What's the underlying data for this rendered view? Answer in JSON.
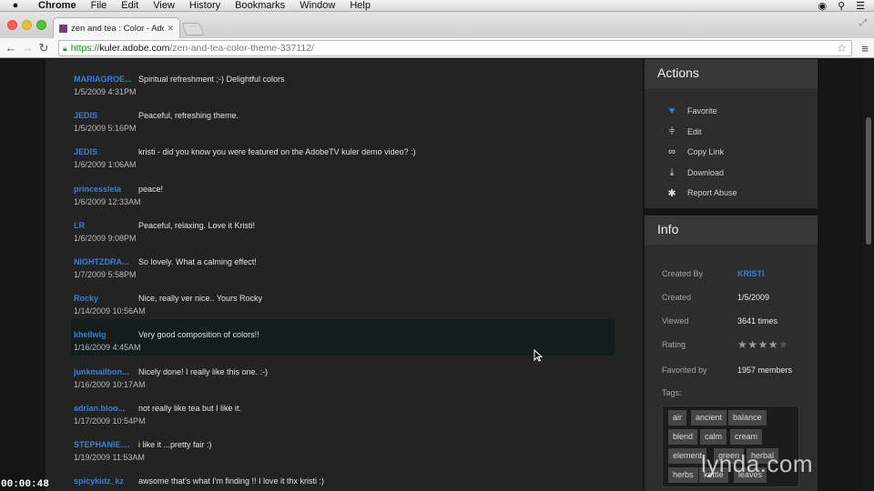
{
  "menubar": {
    "app": "Chrome",
    "items": [
      "File",
      "Edit",
      "View",
      "History",
      "Bookmarks",
      "Window",
      "Help"
    ]
  },
  "tab": {
    "title": "zen and tea : Color - Adobe"
  },
  "address": {
    "scheme": "https://",
    "host": "kuler.adobe.com",
    "path": "/zen-and-tea-color-theme-337112/"
  },
  "comments": [
    {
      "user": "MARIAGROE...",
      "date": "1/5/2009 4:31PM",
      "text": "Spiritual refreshment ;-) Delightful colors"
    },
    {
      "user": "JEDIS",
      "date": "1/5/2009 5:16PM",
      "text": "Peaceful, refreshing theme."
    },
    {
      "user": "JEDIS",
      "date": "1/6/2009 1:06AM",
      "text": "kristi - did you know you were featured on the AdobeTV kuler demo video? :)"
    },
    {
      "user": "princessleia",
      "date": "1/6/2009 12:33AM",
      "text": "peace!"
    },
    {
      "user": "LR",
      "date": "1/6/2009 9:08PM",
      "text": "Peaceful, relaxing. Love it Kristi!"
    },
    {
      "user": "NIGHTZDRA...",
      "date": "1/7/2009 5:58PM",
      "text": "So lovely. What a calming effect!"
    },
    {
      "user": "Rocky",
      "date": "1/14/2009 10:56AM",
      "text": "Nice, really ver nice.. Yours Rocky"
    },
    {
      "user": "khellwig",
      "date": "1/16/2009 4:45AM",
      "text": "Very good composition of colors!!"
    },
    {
      "user": "junkmailbon...",
      "date": "1/16/2009 10:17AM",
      "text": "Nicely done! I really like this one. :-)"
    },
    {
      "user": "adrian.bloo...",
      "date": "1/17/2009 10:54PM",
      "text": "not really like tea but I like it."
    },
    {
      "user": "STEPHANIE....",
      "date": "1/19/2009 11:53AM",
      "text": "i like it ...pretty fair :)"
    },
    {
      "user": "spicykidz_kz",
      "date": "",
      "text": "awsome that's what I'm finding !! I love it thx kristi :)"
    }
  ],
  "actions": {
    "title": "Actions",
    "items": [
      {
        "label": "Favorite",
        "icon": "heart-icon"
      },
      {
        "label": "Edit",
        "icon": "sliders-icon"
      },
      {
        "label": "Copy Link",
        "icon": "link-icon"
      },
      {
        "label": "Download",
        "icon": "download-icon"
      },
      {
        "label": "Report Abuse",
        "icon": "flag-icon"
      }
    ]
  },
  "info": {
    "title": "Info",
    "created_by_label": "Created By",
    "created_by": "KRISTI",
    "created_label": "Created",
    "created": "1/5/2009",
    "viewed_label": "Viewed",
    "viewed": "3641 times",
    "rating_label": "Rating",
    "rating_stars": 3.5,
    "rating_max": 5,
    "favorited_label": "Favorited by",
    "favorited": "1957 members",
    "tags_label": "Tags:",
    "tags": [
      "air",
      "ancient",
      "balance",
      "blend",
      "calm",
      "cream",
      "element",
      "green",
      "herbal",
      "herbs",
      "kettle",
      "leaves"
    ]
  },
  "video": {
    "timecode": "00:00:48",
    "watermark": "lynda.com"
  },
  "colors": {
    "link": "#3c7ed8",
    "heart": "#2f80d8",
    "page_bg": "#232323",
    "panel_bg": "#2d2d2d"
  }
}
